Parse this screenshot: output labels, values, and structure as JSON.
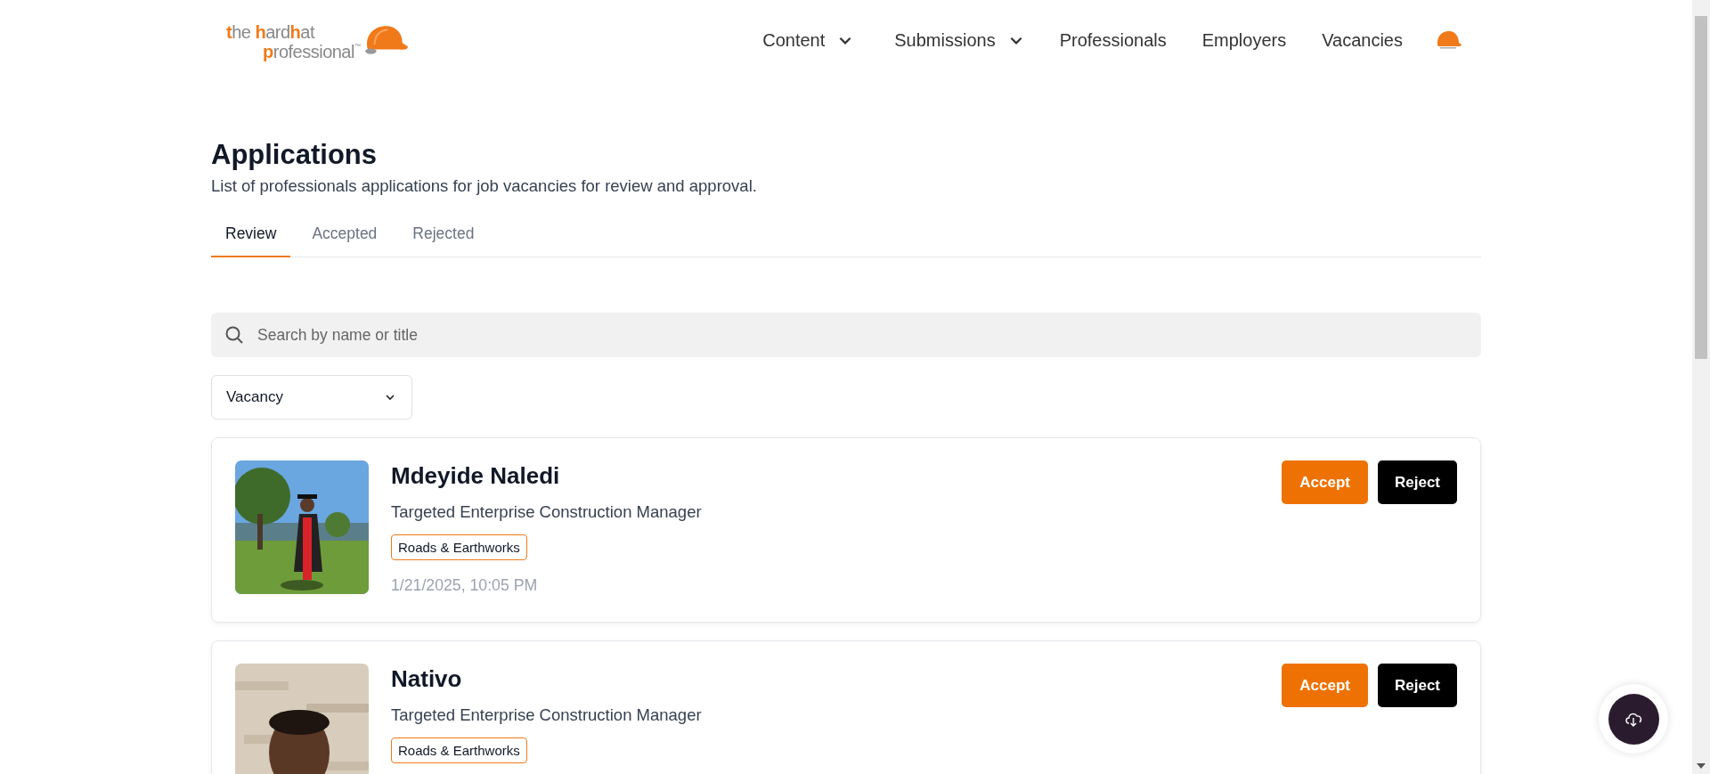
{
  "logo": {
    "parts": [
      {
        "text": "t",
        "accent": true
      },
      {
        "text": "he ",
        "accent": false
      },
      {
        "text": "h",
        "accent": true
      },
      {
        "text": "ard",
        "accent": false
      },
      {
        "text": "h",
        "accent": true
      },
      {
        "text": "at",
        "accent": false
      }
    ],
    "parts2": [
      {
        "text": "p",
        "accent": true
      },
      {
        "text": "rofessional",
        "accent": false
      }
    ],
    "mark": "™"
  },
  "nav": [
    {
      "label": "Content",
      "dropdown": true
    },
    {
      "label": "Submissions",
      "dropdown": true
    },
    {
      "label": "Professionals",
      "dropdown": false
    },
    {
      "label": "Employers",
      "dropdown": false
    },
    {
      "label": "Vacancies",
      "dropdown": false
    }
  ],
  "page": {
    "title": "Applications",
    "subtitle": "List of professionals applications for job vacancies for review and approval."
  },
  "tabs": [
    {
      "label": "Review",
      "selected": true
    },
    {
      "label": "Accepted",
      "selected": false
    },
    {
      "label": "Rejected",
      "selected": false
    }
  ],
  "search": {
    "placeholder": "Search by name or title"
  },
  "filter": {
    "value": "Vacancy"
  },
  "applications": [
    {
      "photo": {
        "kind": "picture"
      },
      "name": "Mdeyide Naledi",
      "job": "Targeted Enterprise Construction Manager",
      "tag": "Roads & Earthworks",
      "date": "1/21/2025, 10:05 PM",
      "actions": [
        "Accept",
        "Reject"
      ]
    },
    {
      "photo": {
        "kind": "picture"
      },
      "name": "Nativo",
      "job": "Targeted Enterprise Construction Manager",
      "tag": "Roads & Earthworks",
      "actions": [
        "Accept",
        "Reject"
      ]
    }
  ]
}
